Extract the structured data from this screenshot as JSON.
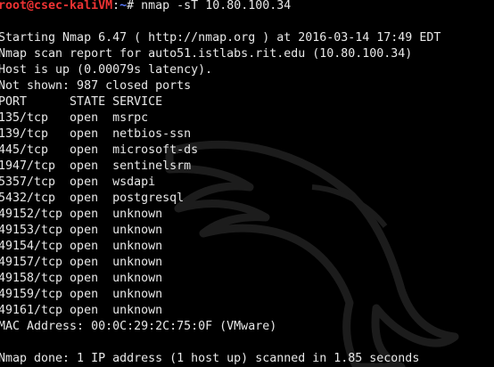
{
  "colors": {
    "background": "#000000",
    "text": "#e8e8e8",
    "prompt_user": "#ee3333",
    "prompt_path": "#5b7cff",
    "watermark": "#1c1c1c"
  },
  "watermark_icon": "kali-dragon-icon",
  "prompt": {
    "user_host": "root@csec-kaliVM",
    "separator": ":",
    "path": "~",
    "symbol": "# ",
    "command": "nmap -sT 10.80.100.34"
  },
  "output": {
    "starting": "Starting Nmap 6.47 ( http://nmap.org ) at 2016-03-14 17:49 EDT",
    "scan_report": "Nmap scan report for auto51.istlabs.rit.edu (10.80.100.34)",
    "host_up": "Host is up (0.00079s latency).",
    "not_shown": "Not shown: 987 closed ports",
    "header": "PORT      STATE SERVICE",
    "ports": [
      "135/tcp   open  msrpc",
      "139/tcp   open  netbios-ssn",
      "445/tcp   open  microsoft-ds",
      "1947/tcp  open  sentinelsrm",
      "5357/tcp  open  wsdapi",
      "5432/tcp  open  postgresql",
      "49152/tcp open  unknown",
      "49153/tcp open  unknown",
      "49154/tcp open  unknown",
      "49157/tcp open  unknown",
      "49158/tcp open  unknown",
      "49159/tcp open  unknown",
      "49161/tcp open  unknown"
    ],
    "mac": "MAC Address: 00:0C:29:2C:75:0F (VMware)",
    "done": "Nmap done: 1 IP address (1 host up) scanned in 1.85 seconds"
  }
}
